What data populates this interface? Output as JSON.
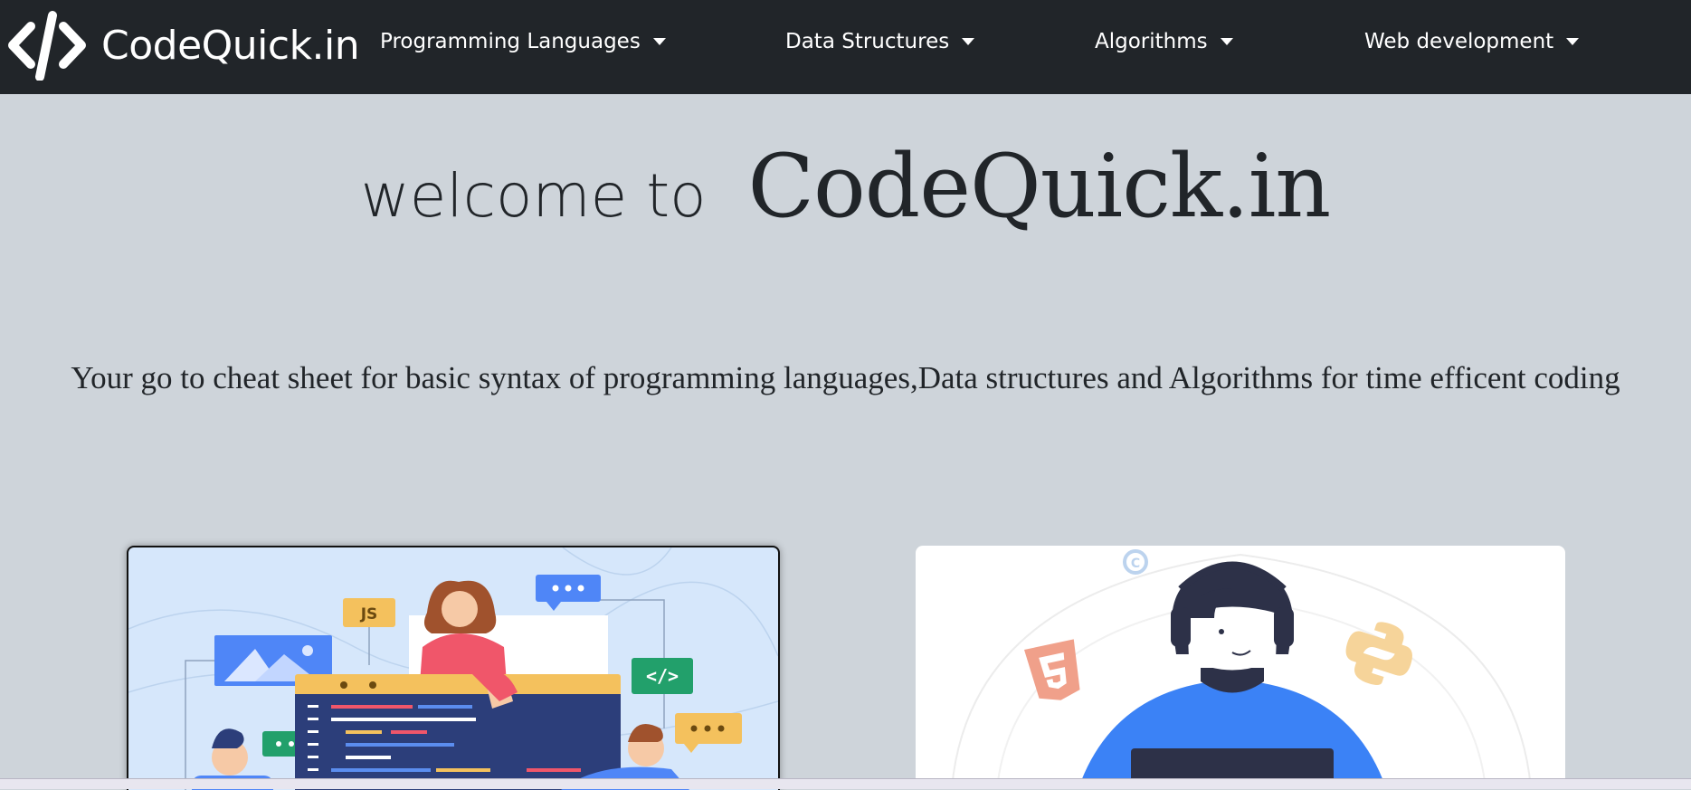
{
  "navbar": {
    "brand": "CodeQuick.in",
    "items": [
      {
        "label": "Programming Languages"
      },
      {
        "label": "Data Structures"
      },
      {
        "label": "Algorithms"
      },
      {
        "label": "Web development"
      }
    ]
  },
  "hero": {
    "welcome": "welcome to",
    "brand": "CodeQuick.in",
    "tagline": "Your go to cheat sheet for basic syntax of programming languages,Data structures and Algorithms for time efficent coding"
  },
  "cards": {
    "left": {
      "badge_js": "JS",
      "badge_code": "</>"
    },
    "right": {
      "badge_c": "C"
    }
  },
  "colors": {
    "navbar": "#212529",
    "page_bg": "#ced4da",
    "accent_blue": "#3b82f6",
    "accent_green": "#22a06b",
    "accent_yellow": "#f4c15d"
  }
}
